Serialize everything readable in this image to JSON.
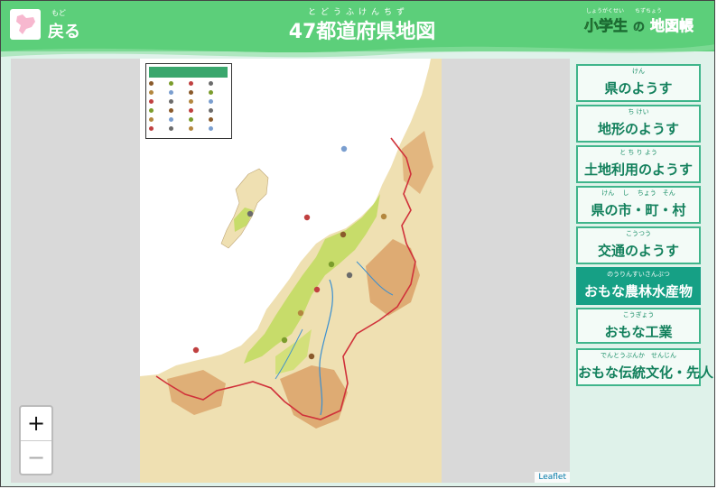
{
  "header": {
    "back_label": "戻る",
    "back_ruby": "もど",
    "title": "47都道府県地図",
    "title_ruby": "とどうふけんちず",
    "logo_part1": "小学生",
    "logo_part2": "の",
    "logo_part3": "地図帳",
    "logo_ruby": "しょうがくせい　　ちずちょう"
  },
  "map": {
    "zoom_in_label": "+",
    "zoom_out_label": "−",
    "attribution": "Leaflet",
    "land_color": "#efe0b2",
    "lowland_color": "#c7dc6a",
    "mountain_color": "#d89a5e",
    "sea_color": "#ffffff",
    "border_color": "#d0313a",
    "river_color": "#3a8fd0"
  },
  "menu": [
    {
      "ruby": "けん",
      "label": "県のようす",
      "active": false
    },
    {
      "ruby": "ち けい",
      "label": "地形のようす",
      "active": false
    },
    {
      "ruby": "と ち り よう",
      "label": "土地利用のようす",
      "active": false
    },
    {
      "ruby": "けん　 し　 ちょう　そん",
      "label": "県の市・町・村",
      "active": false
    },
    {
      "ruby": "こうつう",
      "label": "交通のようす",
      "active": false
    },
    {
      "ruby": "のうりんすいさんぶつ",
      "label": "おもな農林水産物",
      "active": true
    },
    {
      "ruby": "こうぎょう",
      "label": "おもな工業",
      "active": false
    },
    {
      "ruby": "でんとうぶんか　せんじん",
      "label": "おもな伝統文化・先人",
      "active": false
    }
  ],
  "colors": {
    "header_green": "#5ccf7a",
    "menu_active": "#16a085",
    "menu_border": "#3fb58b"
  }
}
